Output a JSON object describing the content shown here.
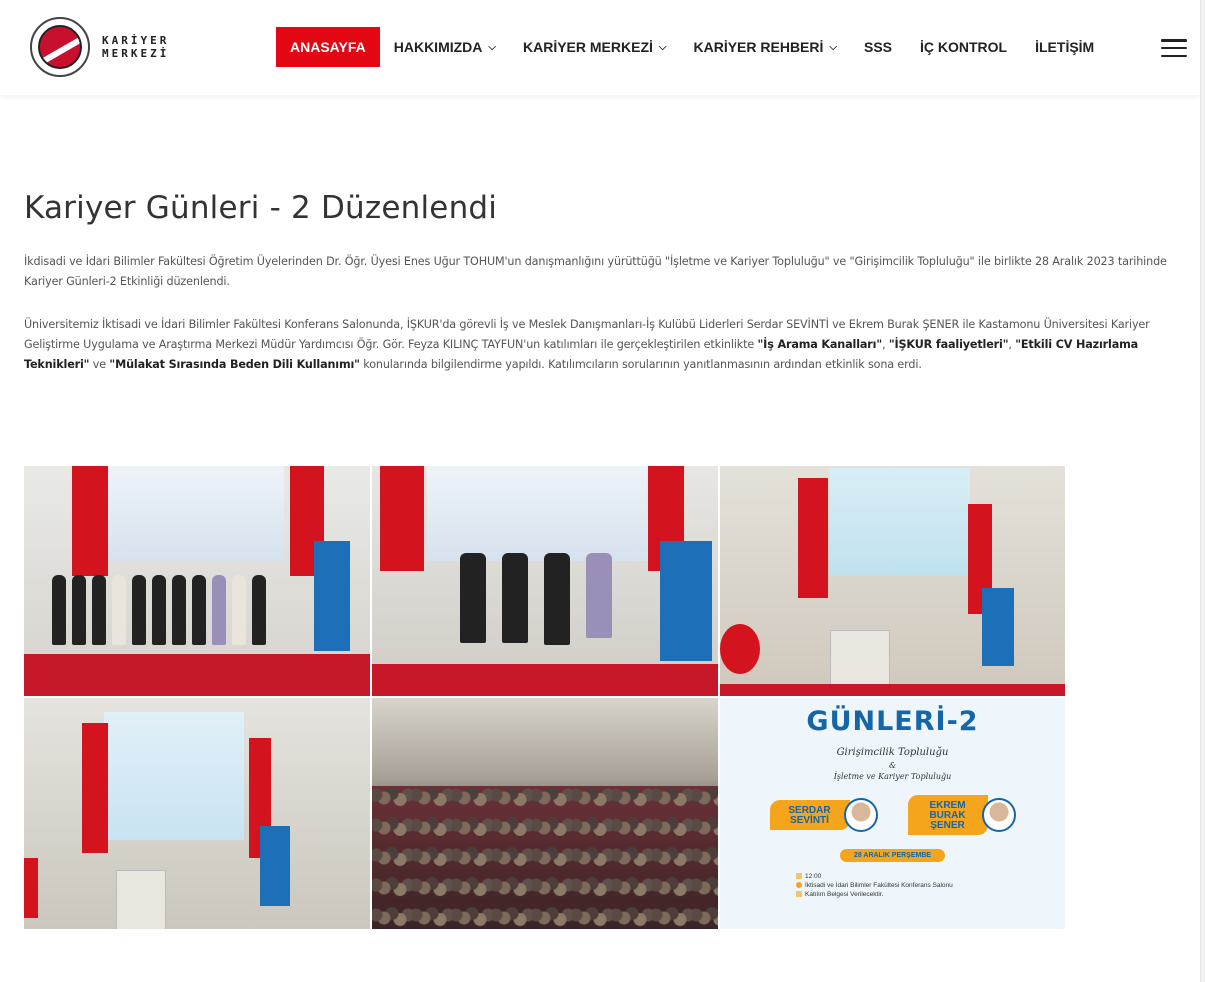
{
  "header": {
    "logo_text_line1": "KARİYER",
    "logo_text_line2": "MERKEZİ",
    "nav": [
      {
        "label": "ANASAYFA",
        "active": true,
        "dropdown": false
      },
      {
        "label": "HAKKIMIZDA",
        "active": false,
        "dropdown": true
      },
      {
        "label": "KARİYER MERKEZİ",
        "active": false,
        "dropdown": true
      },
      {
        "label": "KARİYER REHBERİ",
        "active": false,
        "dropdown": true
      },
      {
        "label": "SSS",
        "active": false,
        "dropdown": false
      },
      {
        "label": "İÇ KONTROL",
        "active": false,
        "dropdown": false
      },
      {
        "label": "İLETİŞİM",
        "active": false,
        "dropdown": false
      }
    ],
    "chevron_glyph": "⌄",
    "accent_color": "#e30613"
  },
  "article": {
    "title": "Kariyer Günleri - 2 Düzenlendi",
    "paragraph1": "İkdisadi ve İdari Bilimler Fakültesi Öğretim Üyelerinden Dr. Öğr. Üyesi Enes Uğur TOHUM'un danışmanlığını yürüttüğü \"İşletme ve Kariyer Topluluğu\" ve \"Girişimcilik Topluluğu\" ile birlikte 28 Aralık 2023 tarihinde Kariyer Günleri-2 Etkinliği düzenlendi.",
    "paragraph2_start": "Üniversitemiz İktisadi ve İdari Bilimler Fakültesi Konferans Salonunda, İŞKUR'da görevli İş ve Meslek Danışmanları-İş Kulübü Liderleri Serdar SEVİNTİ ve Ekrem Burak ŞENER ile Kastamonu Üniversitesi Kariyer Geliştirme Uygulama ve Araştırma Merkezi Müdür Yardımcısı Öğr. Gör. Feyza KILINÇ TAYFUN'un katılımları ile gerçekleştirilen etkinlikte ",
    "topic1": "\"İş Arama Kanalları\"",
    "sep1": ", ",
    "topic2": "\"İŞKUR faaliyetleri\"",
    "sep2": ", ",
    "topic3": "\"Etkili CV Hazırlama Teknikleri\"",
    "sep3": " ve ",
    "topic4": "\"Mülakat Sırasında Beden Dili Kullanımı\"",
    "paragraph2_end": " konularında bilgilendirme yapıldı. Katılımcıların sorularının yanıtlanmasının ardından etkinlik sona erdi."
  },
  "gallery": {
    "photos": [
      {
        "name": "group-photo-stage"
      },
      {
        "name": "speakers-photo-stage"
      },
      {
        "name": "speaker-podium-photo"
      },
      {
        "name": "presentation-photo"
      },
      {
        "name": "audience-photo"
      }
    ],
    "poster": {
      "title": "GÜNLERİ-2",
      "club1": "Girişimcilik Topluluğu",
      "amp": "&",
      "club2": "İşletme ve Kariyer Topluluğu",
      "speaker1": "SERDAR SEVİNTİ",
      "speaker2": "EKREM BURAK ŞENER",
      "date": "28 ARALIK PERŞEMBE",
      "time": "12:00",
      "venue": "İktisadi ve İdari Bilimler Fakültesi Konferans Salonu",
      "certificate": "Katılım Belgesi Verilecektir."
    }
  }
}
